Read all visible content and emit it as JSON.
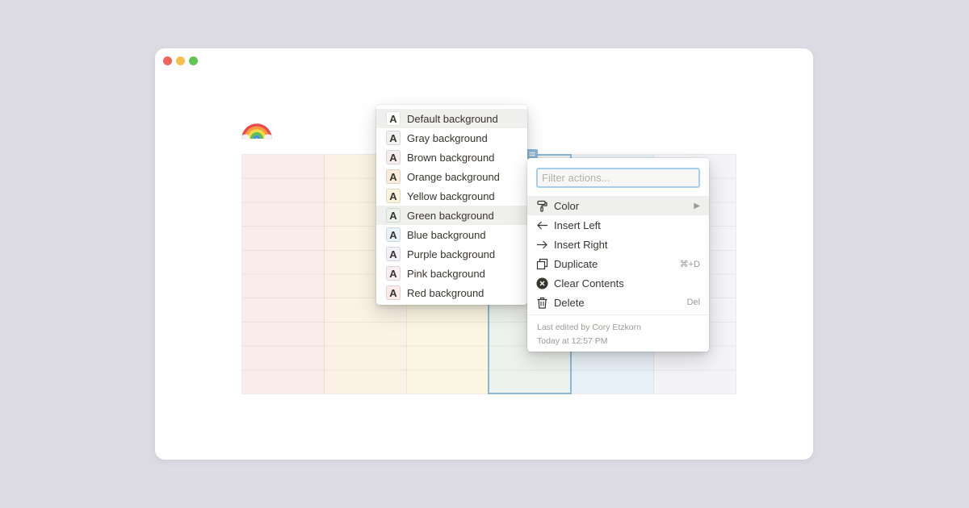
{
  "colors": {
    "background": "#dcdae3",
    "window": "#ffffff",
    "highlight": "#8cb8d6"
  },
  "window": {
    "controls": [
      "close-dot",
      "minimize-dot",
      "zoom-dot"
    ]
  },
  "page": {
    "icon": "rainbow-emoji"
  },
  "table": {
    "columns": [
      {
        "tint": "#fbecec"
      },
      {
        "tint": "#fbf1e4"
      },
      {
        "tint": "#fbf6e2"
      },
      {
        "tint": "#eef2ec",
        "selected": true
      },
      {
        "tint": "#e8f1f7"
      },
      {
        "tint": "#f4f3f7"
      }
    ]
  },
  "color_menu": {
    "glyph": "A",
    "items": [
      {
        "label": "Default background",
        "swatch": "#ffffff",
        "letter": "#37352f"
      },
      {
        "label": "Gray background",
        "swatch": "#f1f1ef",
        "letter": "#37352f"
      },
      {
        "label": "Brown background",
        "swatch": "#f4eeee",
        "letter": "#37352f"
      },
      {
        "label": "Orange background",
        "swatch": "#fbecdd",
        "letter": "#37352f"
      },
      {
        "label": "Yellow background",
        "swatch": "#fbf3db",
        "letter": "#37352f"
      },
      {
        "label": "Green background",
        "swatch": "#edf3ec",
        "letter": "#37352f"
      },
      {
        "label": "Blue background",
        "swatch": "#e7f3f8",
        "letter": "#37352f"
      },
      {
        "label": "Purple background",
        "swatch": "#f4f0f7",
        "letter": "#37352f"
      },
      {
        "label": "Pink background",
        "swatch": "#f9eef3",
        "letter": "#37352f"
      },
      {
        "label": "Red background",
        "swatch": "#fdebec",
        "letter": "#37352f"
      }
    ]
  },
  "action_menu": {
    "filter_placeholder": "Filter actions...",
    "items": [
      {
        "label": "Color",
        "icon": "paint-roller-icon",
        "right": "▶"
      },
      {
        "label": "Insert Left",
        "icon": "arrow-left-icon",
        "right": ""
      },
      {
        "label": "Insert Right",
        "icon": "arrow-right-icon",
        "right": ""
      },
      {
        "label": "Duplicate",
        "icon": "duplicate-icon",
        "right": "⌘+D"
      },
      {
        "label": "Clear Contents",
        "icon": "clear-icon",
        "right": ""
      },
      {
        "label": "Delete",
        "icon": "trash-icon",
        "right": "Del"
      }
    ],
    "meta": {
      "edited_by": "Last edited by Cory Etzkorn",
      "edited_time": "Today at 12:57 PM"
    }
  }
}
